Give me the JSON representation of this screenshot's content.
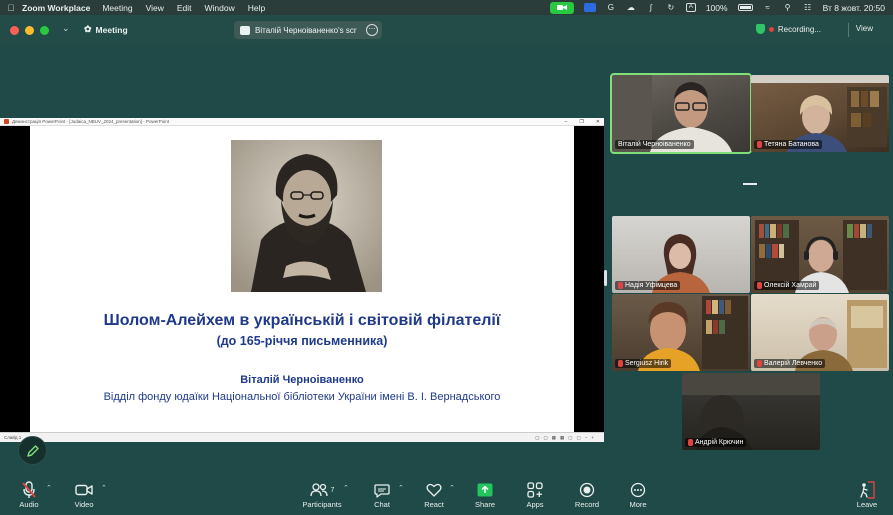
{
  "menubar": {
    "app_name": "Zoom Workplace",
    "items": [
      "Meeting",
      "View",
      "Edit",
      "Window",
      "Help"
    ],
    "battery": "100%",
    "clock": "Вт 8 жовт.  20:50"
  },
  "titlebar": {
    "meeting_label": "Meeting",
    "share_label": "Віталій Черноіваненко's scr",
    "recording_label": "Recording...",
    "view_label": "View"
  },
  "share": {
    "window_title": "Демонстрація PowerPoint - [Judaica_NBUV_2024_presentation] - PowerPoint",
    "status_text": "Слайд 1",
    "slide": {
      "title": "Шолом-Алейхем в українській і світовій філателії",
      "subtitle": "(до 165-річчя письменника)",
      "author": "Віталій Черноіваненко",
      "department": "Відділ фонду юдаїки Національної бібліотеки України імені В. І. Вернадського"
    }
  },
  "participants": [
    {
      "name": "Віталій Черноіваненко",
      "muted": false,
      "active": true
    },
    {
      "name": "Тетяна Батанова",
      "muted": true,
      "active": false
    },
    {
      "name": "Надія Уфімцева",
      "muted": true,
      "active": false
    },
    {
      "name": "Олексій Хамрай",
      "muted": true,
      "active": false
    },
    {
      "name": "Sergiusz Hirik",
      "muted": true,
      "active": false
    },
    {
      "name": "Валерій Левченко",
      "muted": true,
      "active": false
    },
    {
      "name": "Андрій Крючин",
      "muted": true,
      "active": false
    }
  ],
  "toolbar": {
    "audio": "Audio",
    "video": "Video",
    "participants": "Participants",
    "participants_count": "7",
    "chat": "Chat",
    "react": "React",
    "share": "Share",
    "apps": "Apps",
    "record": "Record",
    "more": "More",
    "leave": "Leave"
  },
  "colors": {
    "background": "#1f4a47",
    "slide_text": "#1f3a8a",
    "active_speaker": "#7fe07a",
    "share_green": "#22c55e",
    "muted_red": "#e04343"
  }
}
